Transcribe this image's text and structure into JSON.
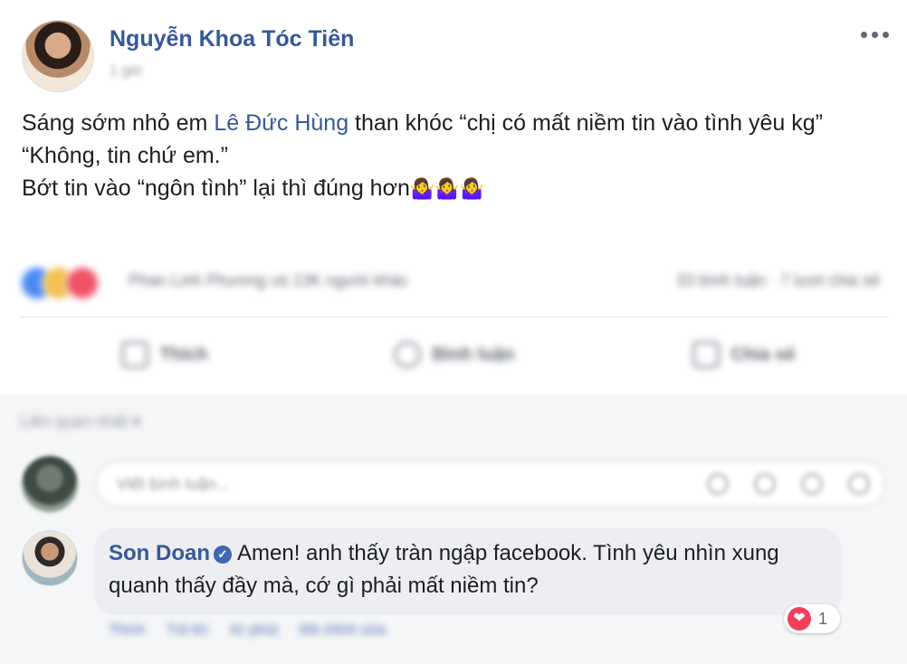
{
  "post": {
    "author": "Nguyễn Khoa Tóc Tiên",
    "timestamp": "1 giờ",
    "text_part1": "Sáng sớm nhỏ em ",
    "mention": "Lê Đức Hùng",
    "text_part2": " than khóc “chị có mất niềm tin vào tình yêu kg”",
    "line2": "“Không, tin chứ em.”",
    "line3": "Bớt tin vào “ngôn tình” lại thì đúng hơn",
    "emojis": "🤷‍♀️🤷‍♀️🤷‍♀️"
  },
  "reactions": {
    "reactors": "Phan Linh Phương và 13K người khác",
    "counts": "33 bình luận · 7 lượt chia sẻ"
  },
  "actions": {
    "like": "Thích",
    "comment": "Bình luận",
    "share": "Chia sẻ"
  },
  "comments_section": {
    "filter_label": "Liên quan nhất ▾",
    "compose_placeholder": "Viết bình luận..."
  },
  "comment": {
    "name": "Son Doan",
    "verified_icon": "✓",
    "text": "Amen! anh thấy tràn ngập facebook. Tình yêu nhìn xung quanh thấy đầy mà, cớ gì phải mất niềm tin?",
    "reaction_icon": "❤",
    "reaction_count": "1",
    "like_link": "Thích",
    "reply_link": "Trả lời",
    "time": "41 phút",
    "edited": "Đã chỉnh sửa"
  }
}
